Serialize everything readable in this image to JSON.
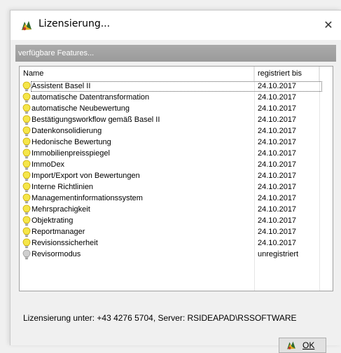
{
  "window": {
    "title": "Lizensierung..."
  },
  "section": {
    "header": "verfügbare Features..."
  },
  "list": {
    "columns": {
      "name": "Name",
      "registered_until": "registriert bis"
    },
    "rows": [
      {
        "name": "Assistent Basel II",
        "date": "24.10.2017",
        "icon": "lightbulb-on-icon"
      },
      {
        "name": "automatische Datentransformation",
        "date": "24.10.2017",
        "icon": "lightbulb-on-icon"
      },
      {
        "name": "automatische Neubewertung",
        "date": "24.10.2017",
        "icon": "lightbulb-on-icon"
      },
      {
        "name": "Bestätigungsworkflow gemäß Basel II",
        "date": "24.10.2017",
        "icon": "lightbulb-on-icon"
      },
      {
        "name": "Datenkonsolidierung",
        "date": "24.10.2017",
        "icon": "lightbulb-on-icon"
      },
      {
        "name": "Hedonische Bewertung",
        "date": "24.10.2017",
        "icon": "lightbulb-on-icon"
      },
      {
        "name": "Immobilienpreisspiegel",
        "date": "24.10.2017",
        "icon": "lightbulb-on-icon"
      },
      {
        "name": "ImmoDex",
        "date": "24.10.2017",
        "icon": "lightbulb-on-icon"
      },
      {
        "name": "Import/Export von Bewertungen",
        "date": "24.10.2017",
        "icon": "lightbulb-on-icon"
      },
      {
        "name": "Interne Richtlinien",
        "date": "24.10.2017",
        "icon": "lightbulb-on-icon"
      },
      {
        "name": "Managementinformationssystem",
        "date": "24.10.2017",
        "icon": "lightbulb-on-icon"
      },
      {
        "name": "Mehrsprachigkeit",
        "date": "24.10.2017",
        "icon": "lightbulb-on-icon"
      },
      {
        "name": "Objektrating",
        "date": "24.10.2017",
        "icon": "lightbulb-on-icon"
      },
      {
        "name": "Reportmanager",
        "date": "24.10.2017",
        "icon": "lightbulb-on-icon"
      },
      {
        "name": "Revisionssicherheit",
        "date": "24.10.2017",
        "icon": "lightbulb-on-icon"
      },
      {
        "name": "Revisormodus",
        "date": "unregistriert",
        "icon": "lightbulb-off-icon"
      }
    ]
  },
  "footer": {
    "info": "Lizensierung unter: +43 4276 5704, Server: RSIDEAPAD\\RSSOFTWARE"
  },
  "buttons": {
    "ok_mnemonic": "O",
    "ok_rest": "K"
  },
  "colors": {
    "header_bar": "#a3a3a3",
    "bulb_on": "#f5e64a",
    "bulb_off": "#cfcfcf",
    "window_bg": "#f0f0f0"
  }
}
